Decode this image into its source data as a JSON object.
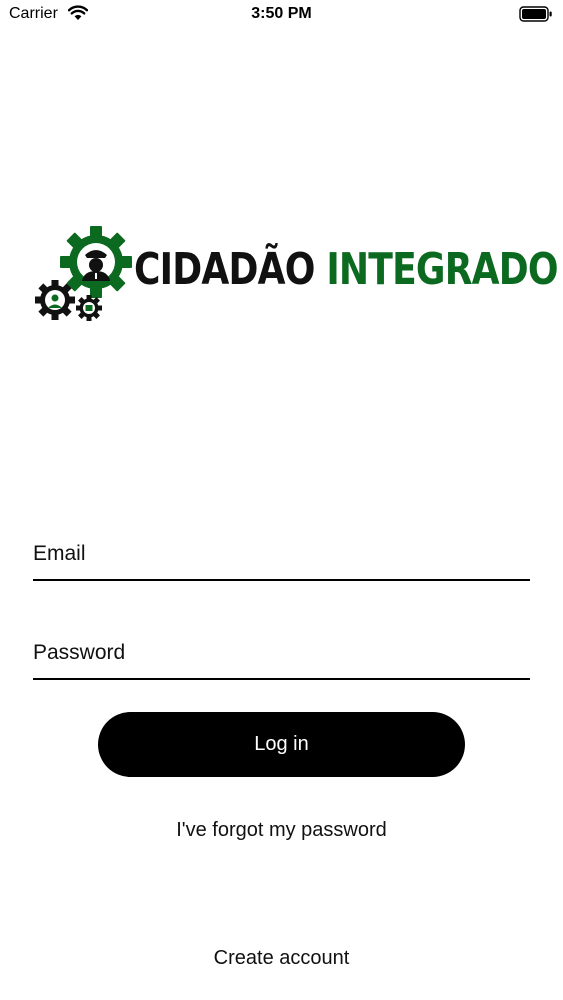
{
  "status_bar": {
    "carrier": "Carrier",
    "time": "3:50 PM",
    "wifi_icon": "wifi-icon",
    "battery_icon": "battery-full-icon"
  },
  "logo": {
    "word_1": "CIDADÃO",
    "word_2": "INTEGRADO",
    "colors": {
      "dark": "#111111",
      "green": "#0b6a1f"
    }
  },
  "form": {
    "email_placeholder": "Email",
    "email_value": "",
    "password_placeholder": "Password",
    "password_value": "",
    "login_label": "Log in",
    "forgot_label": "I've forgot my password",
    "create_account_label": "Create account"
  }
}
